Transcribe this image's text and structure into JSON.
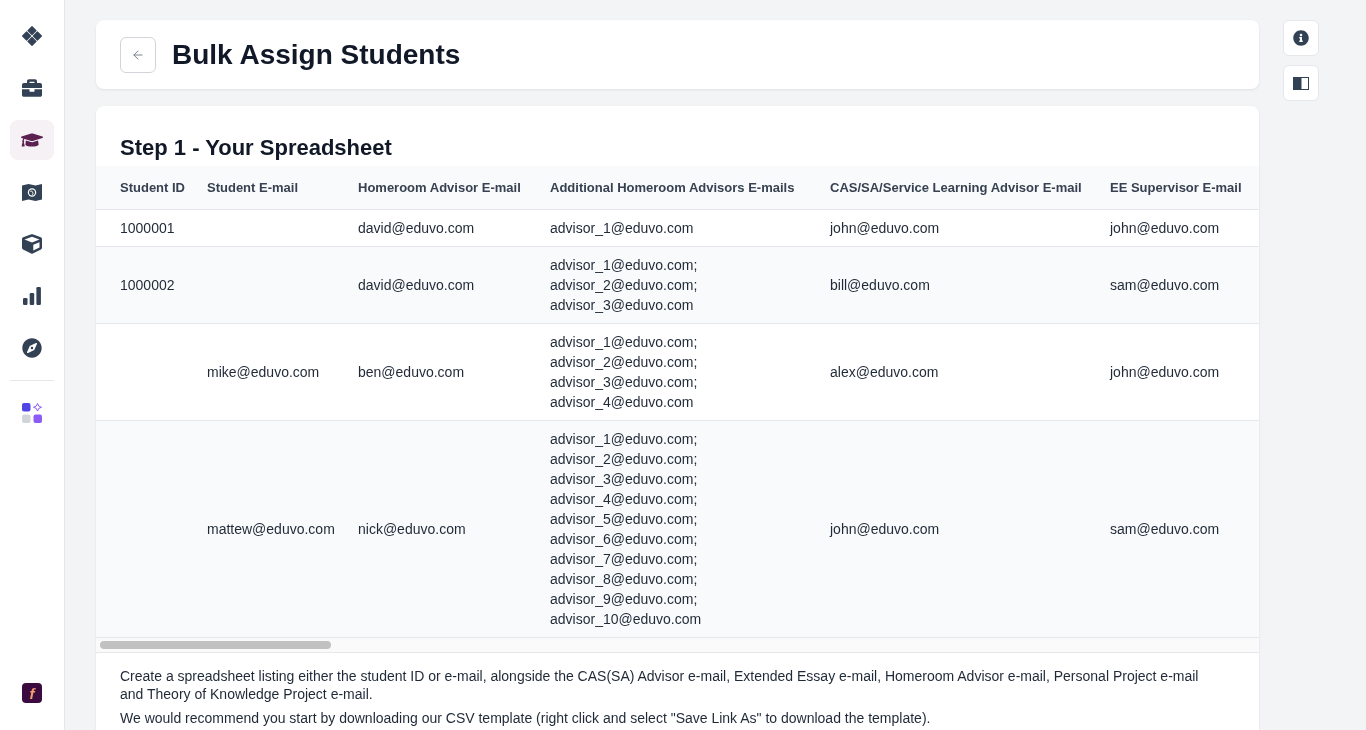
{
  "sidebar": {
    "nav_items": [
      {
        "selected": false
      },
      {
        "selected": false
      },
      {
        "selected": true
      },
      {
        "selected": false
      },
      {
        "selected": false
      },
      {
        "selected": false
      },
      {
        "selected": false
      }
    ],
    "tool_items": [
      {
        "selected": false
      }
    ],
    "logo": "f"
  },
  "header": {
    "title": "Bulk Assign Students"
  },
  "step": {
    "title": "Step 1 - Your Spreadsheet",
    "table": {
      "columns": [
        "Student ID",
        "Student E-mail",
        "Homeroom Advisor E-mail",
        "Additional Homeroom Advisors E-mails",
        "CAS/SA/Service Learning Advisor E-mail",
        "EE Supervisor E-mail"
      ],
      "rows": [
        {
          "student_id": "1000001",
          "homeroom_advisor_email": "david@eduvo.com",
          "additional_homeroom_advisors_emails": "advisor_1@eduvo.com",
          "cas_sa_service_learning_advisor_email": "john@eduvo.com",
          "ee_supervisor_email": "john@eduvo.com"
        },
        {
          "student_id": "1000002",
          "homeroom_advisor_email": "david@eduvo.com",
          "additional_homeroom_advisors_emails": "advisor_1@eduvo.com;\nadvisor_2@eduvo.com;\nadvisor_3@eduvo.com",
          "cas_sa_service_learning_advisor_email": "bill@eduvo.com",
          "ee_supervisor_email": "sam@eduvo.com"
        },
        {
          "student_email": "mike@eduvo.com",
          "homeroom_advisor_email": "ben@eduvo.com",
          "additional_homeroom_advisors_emails": "advisor_1@eduvo.com;\nadvisor_2@eduvo.com;\nadvisor_3@eduvo.com;\nadvisor_4@eduvo.com",
          "cas_sa_service_learning_advisor_email": "alex@eduvo.com",
          "ee_supervisor_email": "john@eduvo.com"
        },
        {
          "student_email": "mattew@eduvo.com",
          "homeroom_advisor_email": "nick@eduvo.com",
          "additional_homeroom_advisors_emails": "advisor_1@eduvo.com;\nadvisor_2@eduvo.com;\nadvisor_3@eduvo.com;\nadvisor_4@eduvo.com;\nadvisor_5@eduvo.com;\nadvisor_6@eduvo.com;\nadvisor_7@eduvo.com;\nadvisor_8@eduvo.com;\nadvisor_9@eduvo.com;\nadvisor_10@eduvo.com",
          "cas_sa_service_learning_advisor_email": "john@eduvo.com",
          "ee_supervisor_email": "sam@eduvo.com"
        }
      ]
    },
    "paragraphs": [
      "Create a spreadsheet listing either the student ID or e-mail, alongside the CAS(SA) Advisor e-mail, Extended Essay e-mail, Homeroom Advisor e-mail, Personal Project e-mail and Theory of Knowledge Project e-mail.",
      "We would recommend you start by downloading our CSV template (right click and select \"Save Link As\" to download the template)."
    ]
  }
}
